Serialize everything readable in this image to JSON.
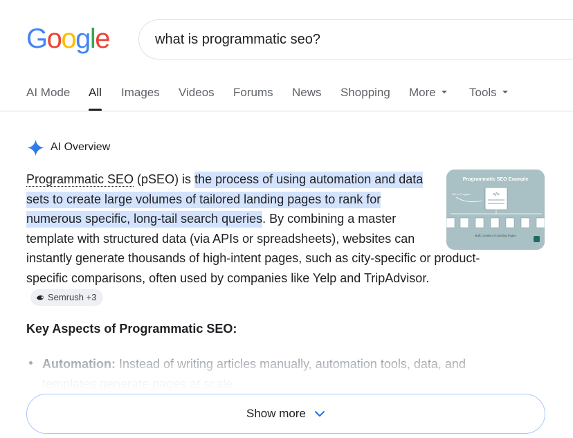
{
  "logo": {
    "letters": [
      "G",
      "o",
      "o",
      "g",
      "l",
      "e"
    ],
    "colors": [
      "#4285F4",
      "#EA4335",
      "#FBBC05",
      "#4285F4",
      "#34A853",
      "#EA4335"
    ]
  },
  "search": {
    "value": "what is programmatic seo?"
  },
  "tabs": [
    {
      "label": "AI Mode"
    },
    {
      "label": "All",
      "active": true
    },
    {
      "label": "Images"
    },
    {
      "label": "Videos"
    },
    {
      "label": "Forums"
    },
    {
      "label": "News"
    },
    {
      "label": "Shopping"
    },
    {
      "label": "More",
      "dropdown": true
    },
    {
      "label": "Tools",
      "dropdown": true
    }
  ],
  "ai_overview": {
    "title": "AI Overview",
    "icon": "sparkle-icon",
    "paragraph": {
      "term": "Programmatic SEO",
      "after_term": " (pSEO) is ",
      "highlight": "the process of using automation and data sets to create large volumes of tailored landing pages to rank for numerous specific, long-tail search queries",
      "rest": ". By combining a master template with structured data (via APIs or spreadsheets), websites can instantly generate thousands of high-intent pages, such as city-specific or product-specific comparisons, often used by companies like Yelp and TripAdvisor."
    },
    "source_chip": {
      "label": "Semrush +3",
      "icon": "semrush-icon"
    },
    "thumbnail": {
      "title": "Programmatic SEO Example",
      "caption": "Bulk Creation of Landing Pages",
      "side_label": "DB or Program",
      "code_glyph": "</>"
    },
    "key_heading": "Key Aspects of Programmatic SEO:",
    "bullets": [
      {
        "label": "Automation:",
        "text": " Instead of writing articles manually, automation tools, data, and templates generate pages at scale."
      }
    ],
    "show_more": {
      "label": "Show more",
      "icon": "chevron-down-icon"
    }
  },
  "colors": {
    "highlight": "#d3e3fd",
    "accent_blue": "#4285F4",
    "text": "#202124",
    "muted": "#5f6368"
  }
}
